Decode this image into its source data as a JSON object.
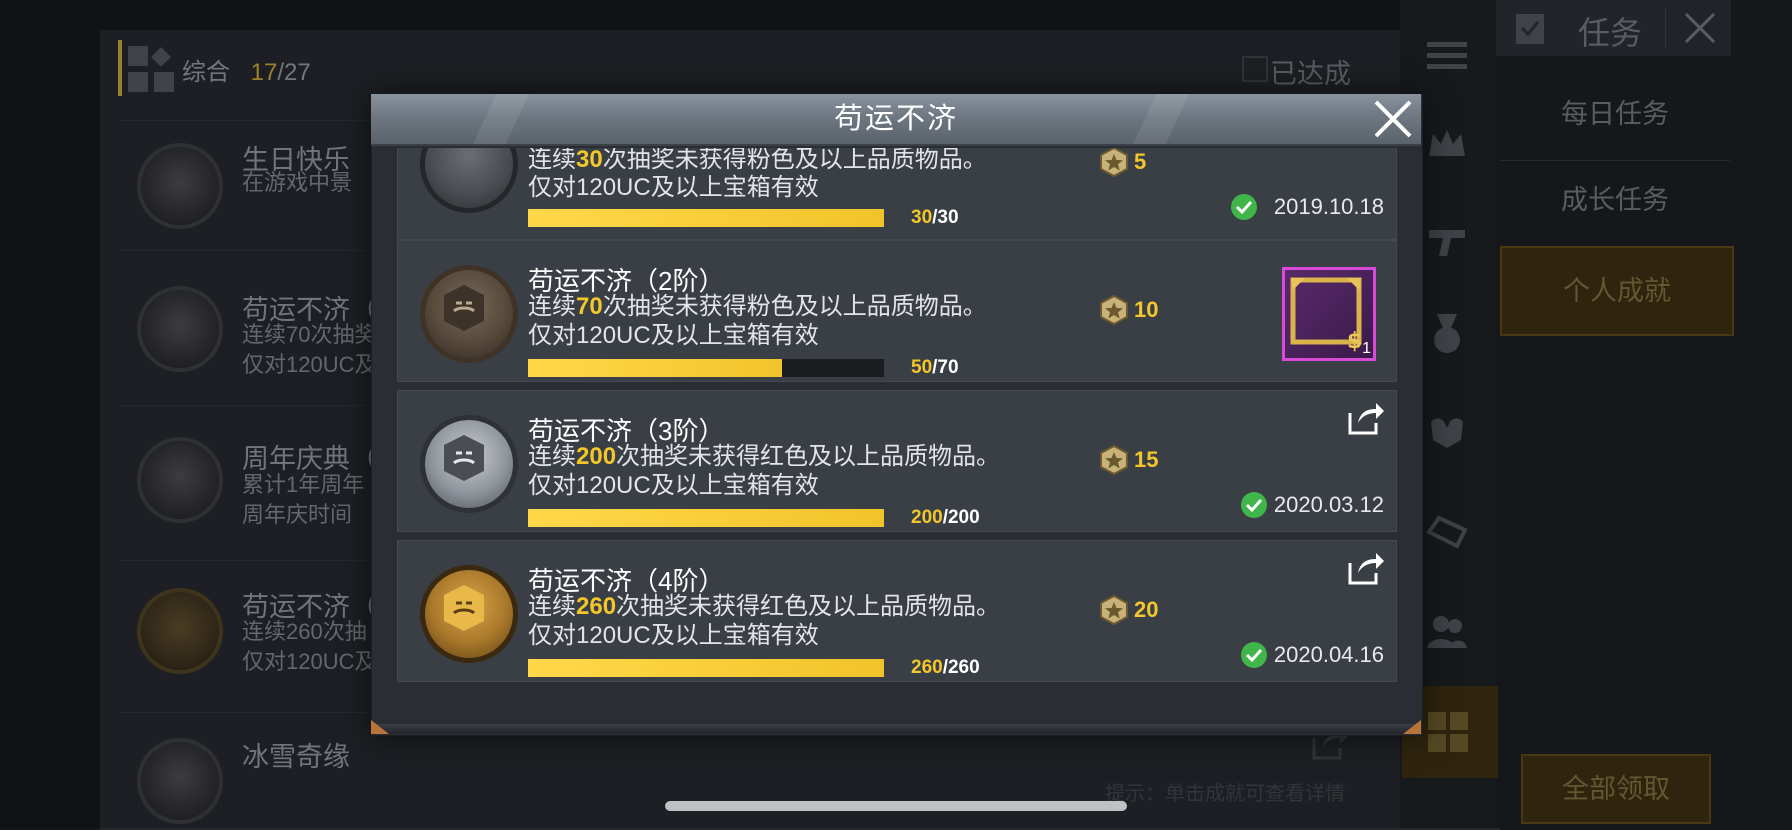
{
  "background": {
    "category": {
      "label": "综合",
      "progress": "17",
      "total": "/27"
    },
    "achieved_filter": "已达成",
    "topbar": {
      "title": "任务"
    },
    "tabs": [
      "每日任务",
      "成长任务",
      "个人成就"
    ],
    "claim_all": "全部领取",
    "hint": "提示：单击成就可查看详情",
    "rows": [
      {
        "title": "生日快乐",
        "line1": "在游戏中景",
        "line2": ""
      },
      {
        "title": "苟运不济（",
        "line1": "连续70次抽奖",
        "line2": "仅对120UC及"
      },
      {
        "title": "周年庆典（",
        "line1": "累计1年周年",
        "line2": "周年庆时间"
      },
      {
        "title": "苟运不济（",
        "line1": "连续260次抽",
        "line2": "仅对120UC及"
      },
      {
        "title": "冰雪奇缘",
        "line1": "",
        "line2": ""
      }
    ]
  },
  "modal": {
    "title": "苟运不济",
    "items": [
      {
        "title": "",
        "desc_prefix": "连续",
        "desc_num": "30",
        "desc_suffix": "次抽奖未获得粉色及以上品质物品。",
        "desc_line2": "仅对120UC及以上宝箱有效",
        "progress_current": "30",
        "progress_max": "/30",
        "progress_fraction": 1.0,
        "points": "5",
        "completed_date": "2019.10.18"
      },
      {
        "title": "苟运不济（2阶）",
        "desc_prefix": "连续",
        "desc_num": "70",
        "desc_suffix": "次抽奖未获得粉色及以上品质物品。",
        "desc_line2": "仅对120UC及以上宝箱有效",
        "progress_current": "50",
        "progress_max": "/70",
        "progress_fraction": 0.714,
        "points": "10",
        "reward_count": "1"
      },
      {
        "title": "苟运不济（3阶）",
        "desc_prefix": "连续",
        "desc_num": "200",
        "desc_suffix": "次抽奖未获得红色及以上品质物品。",
        "desc_line2": "仅对120UC及以上宝箱有效",
        "progress_current": "200",
        "progress_max": "/200",
        "progress_fraction": 1.0,
        "points": "15",
        "completed_date": "2020.03.12"
      },
      {
        "title": "苟运不济（4阶）",
        "desc_prefix": "连续",
        "desc_num": "260",
        "desc_suffix": "次抽奖未获得红色及以上品质物品。",
        "desc_line2": "仅对120UC及以上宝箱有效",
        "progress_current": "260",
        "progress_max": "/260",
        "progress_fraction": 1.0,
        "points": "20",
        "completed_date": "2020.04.16"
      }
    ]
  },
  "colors": {
    "accent_yellow": "#f3c72a",
    "check_green": "#3fb54a",
    "reward_border": "#d84bd8"
  },
  "icons": {
    "close": "close-icon",
    "share": "share-icon",
    "check": "check-icon",
    "points": "achievement-points-icon"
  }
}
